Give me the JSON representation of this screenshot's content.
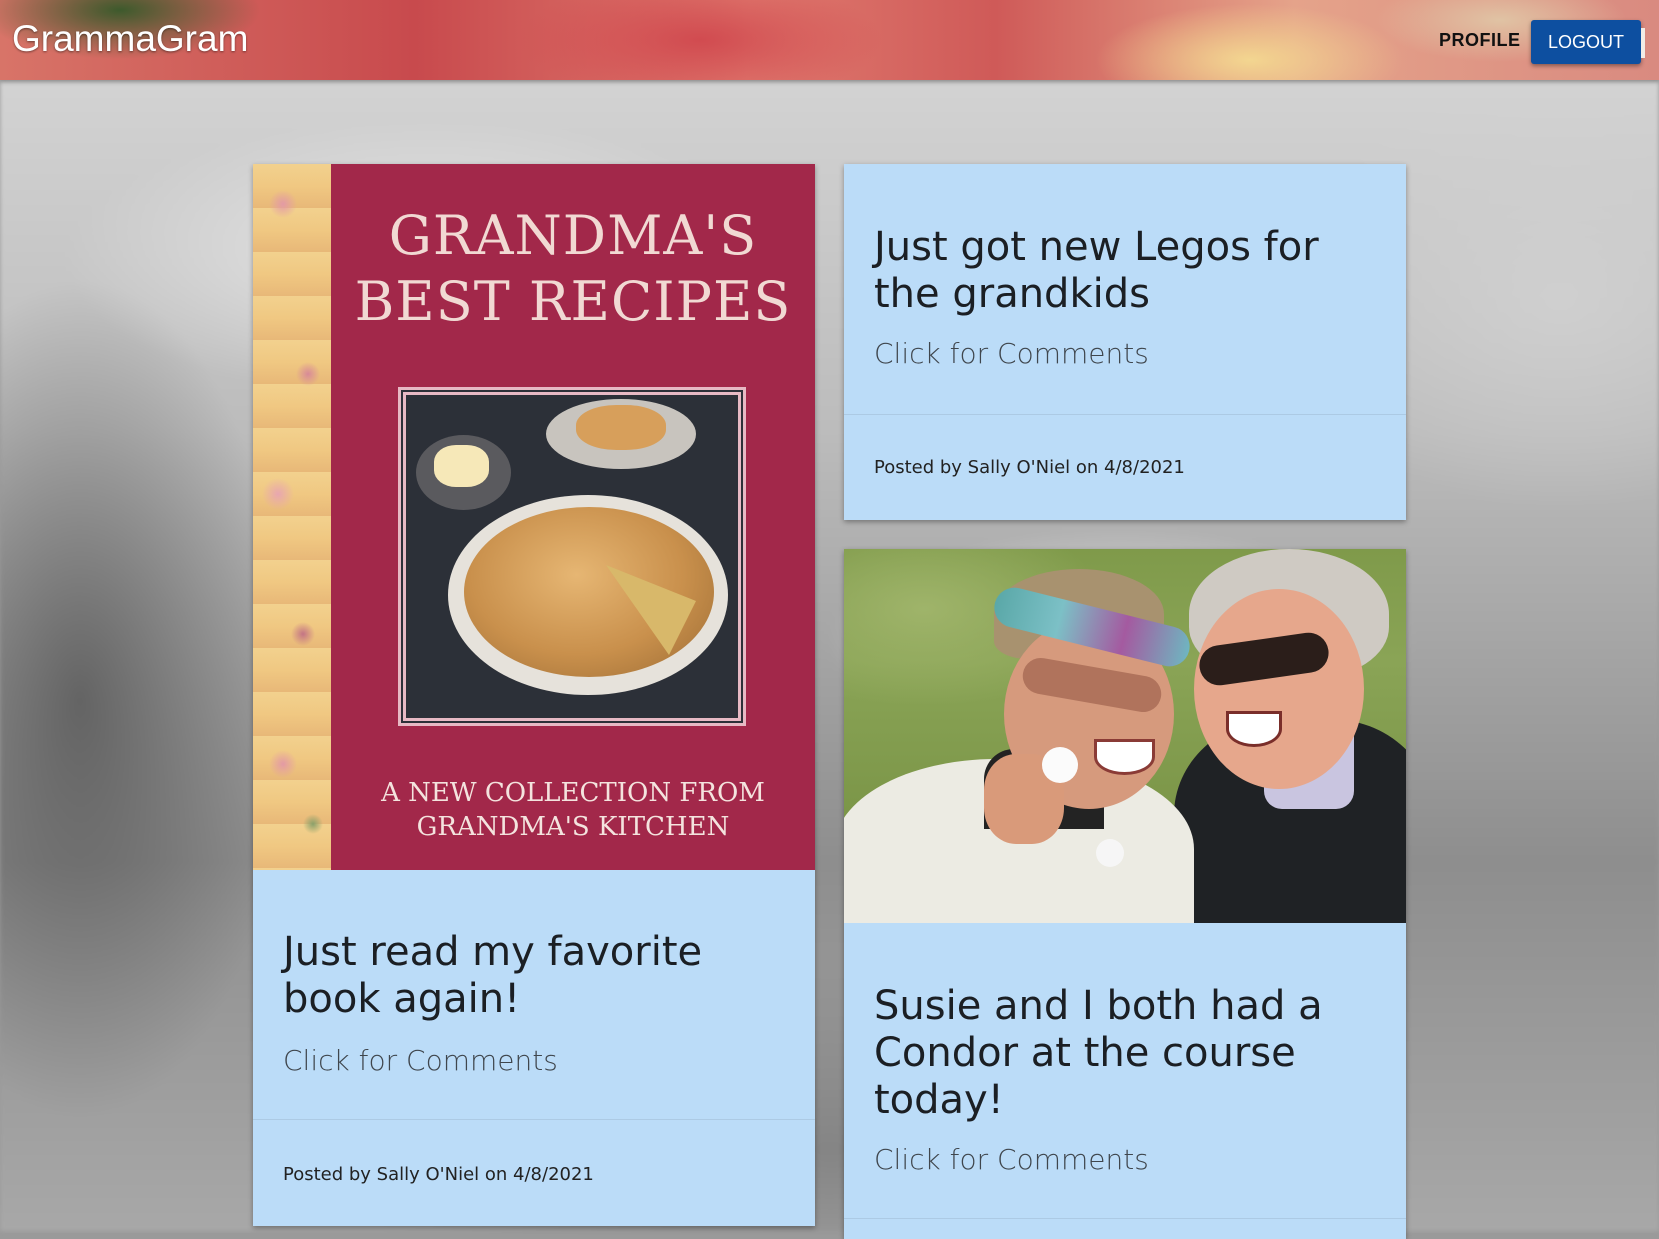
{
  "app": {
    "brand": "GrammaGram"
  },
  "nav": {
    "profile_label": "PROFILE",
    "logout_label": "LOGOUT"
  },
  "colors": {
    "card_bg": "#bbdcf8",
    "logout_bg": "#0d4fa0",
    "cover_bg": "#a2284a"
  },
  "posts": [
    {
      "image": "book-cover-image",
      "cover_title_line1": "GRANDMA'S",
      "cover_title_line2": "BEST RECIPES",
      "cover_sub_line1": "A NEW COLLECTION FROM",
      "cover_sub_line2": "GRANDMA'S KITCHEN",
      "title": "Just read my favorite book again!",
      "link": "Click for Comments",
      "footer": "Posted by Sally O'Niel on 4/8/2021"
    },
    {
      "image": null,
      "title": "Just got new Legos for the grandkids",
      "link": "Click for Comments",
      "footer": "Posted by Sally O'Niel on 4/8/2021"
    },
    {
      "image": "golf-friends-photo",
      "title": "Susie and I both had a Condor at the course today!",
      "link": "Click for Comments"
    }
  ]
}
